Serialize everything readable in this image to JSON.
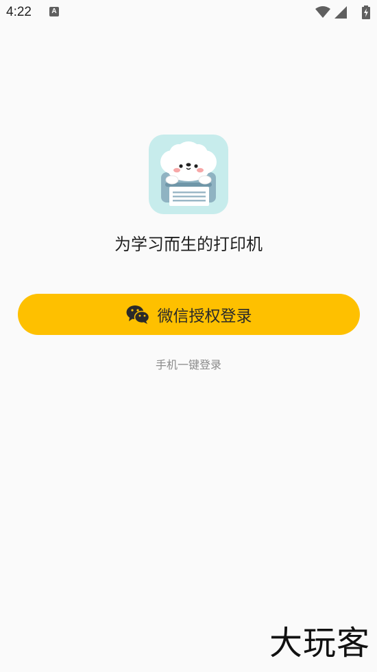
{
  "status_bar": {
    "time": "4:22",
    "notification_icon": "A",
    "icons": [
      "wifi-icon",
      "signal-icon",
      "battery-charging-icon"
    ]
  },
  "app": {
    "icon": "printer-dog-app-icon",
    "tagline": "为学习而生的打印机"
  },
  "login": {
    "wechat_button_label": "微信授权登录",
    "wechat_icon": "wechat-icon",
    "phone_login_label": "手机一键登录",
    "accent_color": "#fec000"
  },
  "watermark": {
    "text": "大玩客"
  }
}
